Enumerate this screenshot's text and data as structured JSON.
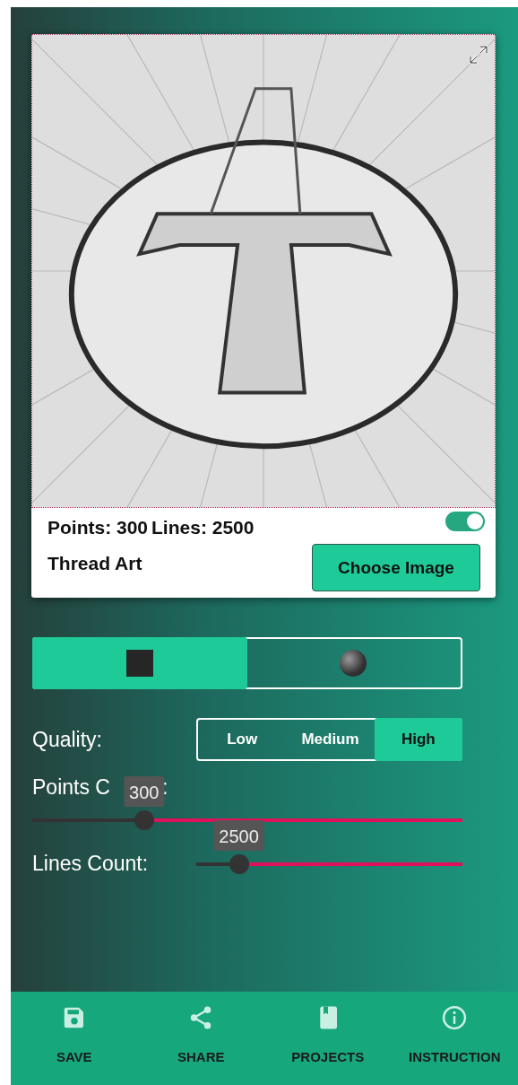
{
  "stats": {
    "points": "Points: 300",
    "lines": "Lines: 2500"
  },
  "toggle": {
    "on": true
  },
  "title": "Thread Art",
  "choose_button": "Choose Image",
  "shape_tabs": [
    {
      "kind": "square",
      "selected": true
    },
    {
      "kind": "circle",
      "selected": false
    }
  ],
  "quality": {
    "label": "Quality:",
    "options": [
      {
        "label": "Low",
        "selected": false
      },
      {
        "label": "Medium",
        "selected": false
      },
      {
        "label": "High",
        "selected": true
      }
    ]
  },
  "sliders": [
    {
      "label": "Points C",
      "label_end": ":",
      "value": "300",
      "level": 0.26
    },
    {
      "label": "Lines Count:",
      "value": "2500",
      "level": 0.16
    }
  ],
  "nav": [
    {
      "kind": "save",
      "label": "SAVE"
    },
    {
      "kind": "share",
      "label": "SHARE"
    },
    {
      "kind": "projects",
      "label": "PROJECTS"
    },
    {
      "kind": "info",
      "label": "INSTRUCTION"
    }
  ]
}
